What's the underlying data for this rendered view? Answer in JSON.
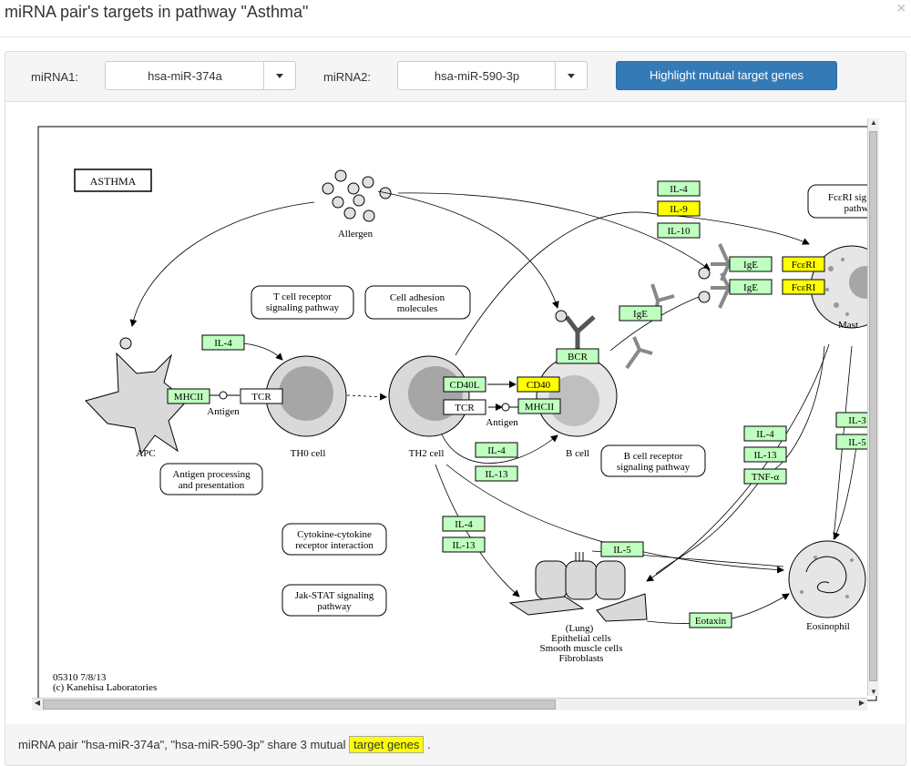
{
  "dialog": {
    "title": "miRNA pair's targets in pathway \"Asthma\"",
    "close_glyph": "×"
  },
  "toolbar": {
    "mirna1_label": "miRNA1:",
    "mirna1_value": "hsa-miR-374a",
    "mirna2_label": "miRNA2:",
    "mirna2_value": "hsa-miR-590-3p",
    "highlight_button": "Highlight mutual target genes"
  },
  "pathway": {
    "title": "ASTHMA",
    "labels": {
      "allergen": "Allergen",
      "apc": "APC",
      "th0": "TH0 cell",
      "th2": "TH2 cell",
      "bcell": "B cell",
      "antigen1": "Antigen",
      "antigen2": "Antigen",
      "mast": "Mast",
      "eosinophil": "Eosinophil",
      "lung": "(Lung)",
      "epithelial": "Epithelial cells",
      "smooth": "Smooth muscle cells",
      "fibro": "Fibroblasts",
      "footer1": "05310 7/8/13",
      "footer2": "(c) Kanehisa Laboratories"
    },
    "boxes": {
      "tcr_path1": "T cell receptor",
      "tcr_path2": "signaling pathway",
      "adhesion1": "Cell adhesion",
      "adhesion2": "molecules",
      "antigen_proc1": "Antigen processing",
      "antigen_proc2": "and presentation",
      "bcr_path1": "B cell receptor",
      "bcr_path2": "signaling pathway",
      "cytokine1": "Cytokine-cytokine",
      "cytokine2": "receptor interaction",
      "jak1": "Jak-STAT signaling",
      "jak2": "pathway",
      "fceri1": "FcεRI sig",
      "fceri2": "pathw"
    },
    "genes": {
      "il4_top": "IL-4",
      "il9": "IL-9",
      "il10": "IL-10",
      "ige_a": "IgE",
      "fceri_a": "FcεRI",
      "ige_b": "IgE",
      "fceri_b": "FcεRI",
      "ige_c": "IgE",
      "il4_apc": "IL-4",
      "mhcii_apc": "MHCII",
      "tcr_th0": "TCR",
      "bcr": "BCR",
      "cd40l": "CD40L",
      "cd40": "CD40",
      "tcr_th2": "TCR",
      "mhcii_b": "MHCII",
      "il4_mid": "IL-4",
      "il13_mid": "IL-13",
      "il4_r": "IL-4",
      "il13_r": "IL-13",
      "tnfa": "TNF-α",
      "il3_edge": "IL-3",
      "il5_edge": "IL-5",
      "il4_low": "IL-4",
      "il13_low": "IL-13",
      "il5_low": "IL-5",
      "eotaxin": "Eotaxin"
    },
    "colors": {
      "gene_fill": "#bfffbf",
      "target_fill": "#ffff00",
      "cell_fill": "#d9d9d9",
      "nucleus_fill": "#a6a6a6"
    }
  },
  "footer": {
    "prefix": "miRNA pair \"hsa-miR-374a\", \"hsa-miR-590-3p\" share 3 mutual",
    "link": "target genes",
    "suffix": "."
  }
}
